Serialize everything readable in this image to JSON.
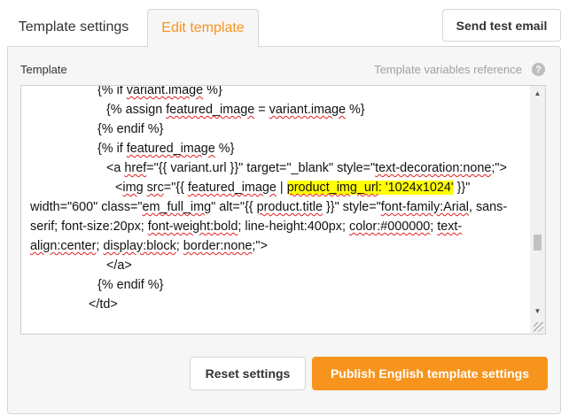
{
  "tabs": {
    "settings_label": "Template settings",
    "edit_label": "Edit template"
  },
  "header": {
    "send_test_label": "Send test email"
  },
  "panel": {
    "template_label": "Template",
    "variables_reference": "Template variables reference",
    "help_glyph": "?"
  },
  "code": {
    "l1_pre": "{% if ",
    "l1_sq": "variant.image",
    "l1_post": " %}",
    "l2_a": "{% assign ",
    "l2_sq1": "featured_image",
    "l2_b": " = ",
    "l2_sq2": "variant.image",
    "l2_c": " %}",
    "l3": "{% endif %}",
    "l4_pre": "{% if ",
    "l4_sq": "featured_image",
    "l4_post": " %}",
    "l5_a": "<a ",
    "l5_sq1": "href",
    "l5_b": "=\"{{ variant.url }}\" target=\"_blank\" style=\"",
    "l5_sq2": "text-decoration:none",
    "l5_c": ";\">",
    "l6_a": "<",
    "l6_sq1": "img",
    "l6_b": " ",
    "l6_sq2": "src",
    "l6_c": "=\"{{ ",
    "l6_sq3": "featured_image",
    "l6_d": " | ",
    "l6_hl1": "product_img_url",
    "l6_hl2": ": '1024x1024'",
    "l6_e": " }}\" width=\"600\" class=\"",
    "l6_sq4": "em_full_img",
    "l6_f": "\" alt=\"{{ ",
    "l6_sq5": "product.title",
    "l6_g": " }}\" style=\"",
    "l6_sq6": "font-family:Arial",
    "l6_h": ", sans-serif; font-size:20px; ",
    "l6_sq7": "font-weight:bold",
    "l6_i": "; line-height:400px; ",
    "l6_sq8": "color:#000000",
    "l6_j": "; ",
    "l6_sq9": "text-align:center",
    "l6_k": "; ",
    "l6_sq10": "display:block",
    "l6_l": "; ",
    "l6_sq11": "border:none",
    "l6_m": ";\">",
    "l7": "</a>",
    "l8": "{% endif %}",
    "l9": "</td>"
  },
  "footer": {
    "reset_label": "Reset settings",
    "publish_label": "Publish English template settings"
  },
  "colors": {
    "accent": "#f7941d",
    "highlight": "#ffff00",
    "spellcheck": "#e02020"
  },
  "icons": {
    "help": "question-circle-icon",
    "scroll_up": "triangle-up-icon",
    "scroll_down": "triangle-down-icon",
    "resize": "resize-grip-icon"
  }
}
